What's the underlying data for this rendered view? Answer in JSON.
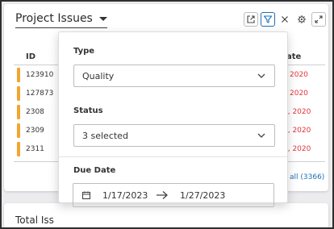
{
  "header": {
    "title": "Project Issues"
  },
  "toolbar": {
    "icons": [
      "open-external-icon",
      "filter-icon",
      "close-icon",
      "gear-icon",
      "expand-icon"
    ]
  },
  "table": {
    "columns": {
      "id": "ID",
      "date_partial": "ate"
    },
    "rows": [
      {
        "id": "123910",
        "date_partial": "2020"
      },
      {
        "id": "127873",
        "date_partial": "2020"
      },
      {
        "id": "2308",
        "date_partial": "0, 2020"
      },
      {
        "id": "2309",
        "date_partial": "0, 2020"
      },
      {
        "id": "2311",
        "date_partial": "0, 2020"
      }
    ],
    "view_all_partial": "all (3366)"
  },
  "bottom_card": {
    "title_partial": "Total Iss"
  },
  "filter_panel": {
    "type_label": "Type",
    "type_value": "Quality",
    "status_label": "Status",
    "status_value": "3 selected",
    "due_date_label": "Due Date",
    "due_date_start": "1/17/2023",
    "due_date_end": "1/27/2023"
  },
  "colors": {
    "accent": "#1f6fb5",
    "flag": "#f2a631",
    "overdue": "#e0333b"
  }
}
